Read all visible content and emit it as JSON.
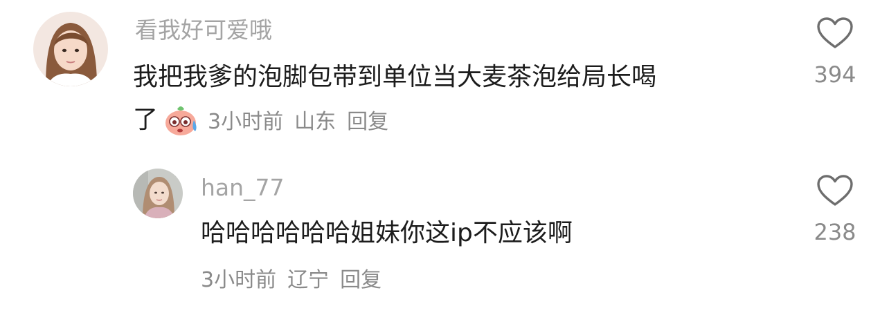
{
  "comments": [
    {
      "username": "看我好可爱哦",
      "text_line1": "我把我爹的泡脚包带到单位当大麦茶泡给局长喝",
      "text_line2": "了",
      "emoji": "sweat-smile-emoji",
      "time": "3小时前",
      "location": "山东",
      "reply_label": "回复",
      "likes": "394"
    },
    {
      "username": "han_77",
      "text": "哈哈哈哈哈哈姐妹你这ip不应该啊",
      "time": "3小时前",
      "location": "辽宁",
      "reply_label": "回复",
      "likes": "238"
    }
  ],
  "icons": {
    "like": "heart-outline-icon"
  },
  "colors": {
    "username": "#a4a4a4",
    "text": "#1c1c1c",
    "meta": "#8a8a8a",
    "icon": "#6e6e6e"
  }
}
